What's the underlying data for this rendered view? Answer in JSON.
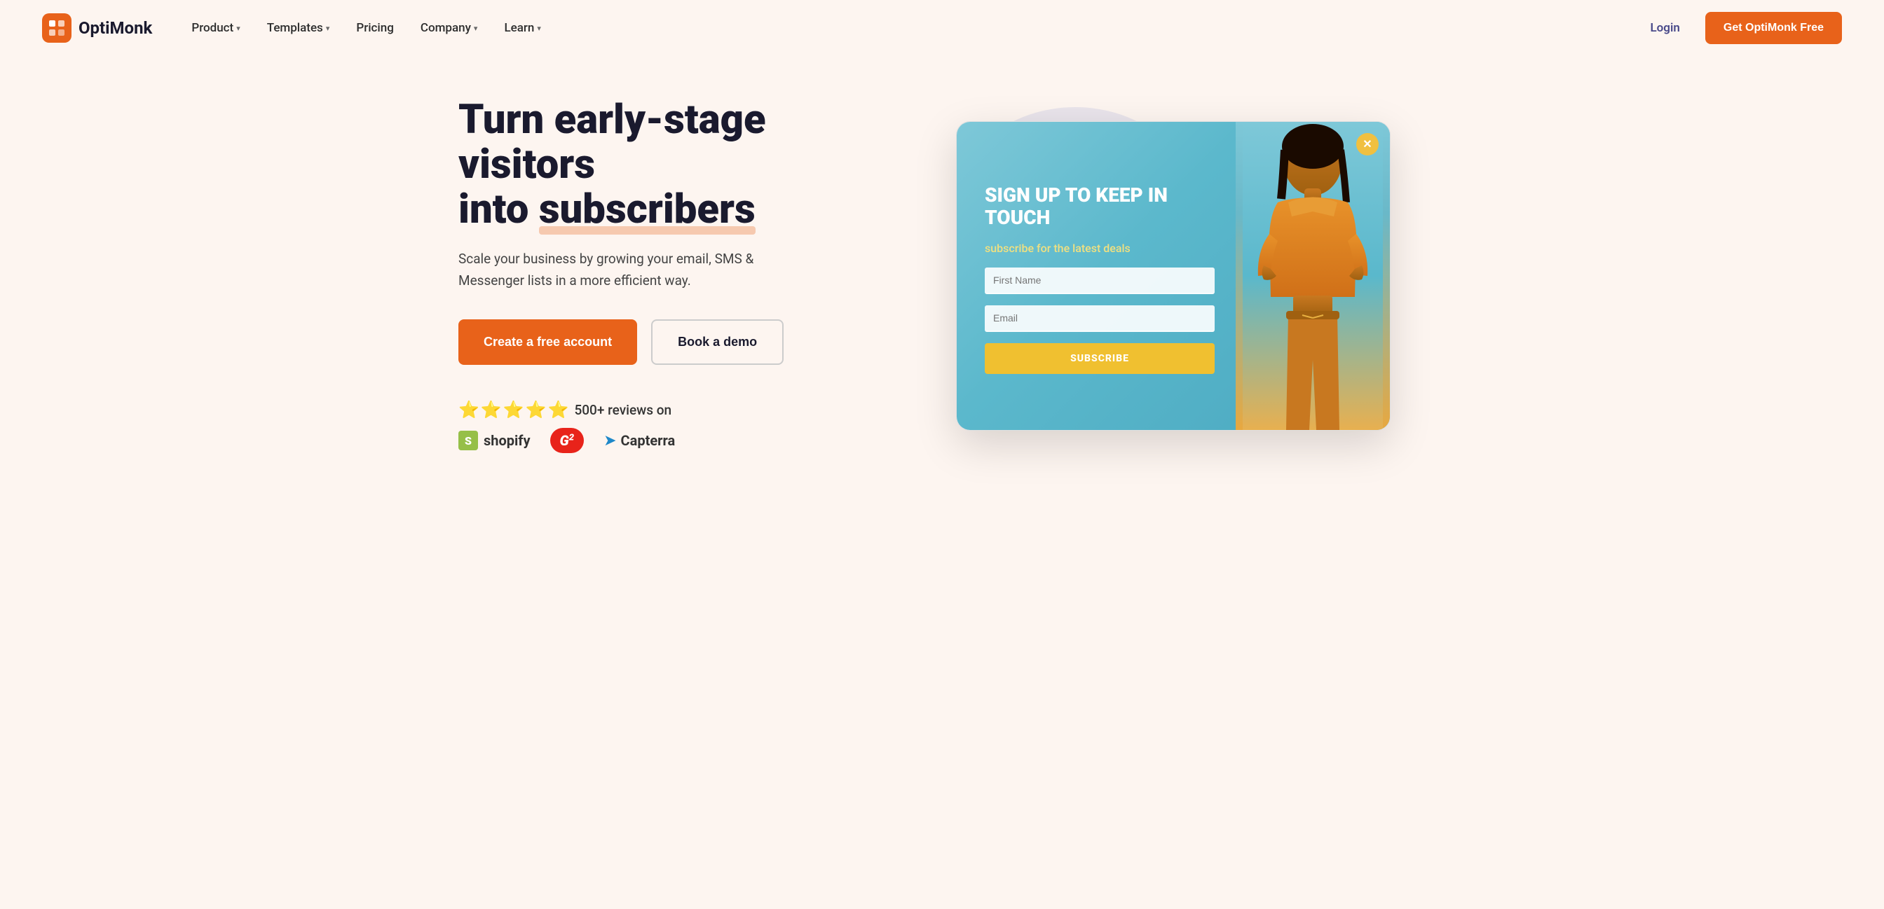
{
  "brand": {
    "name": "OptiMonk",
    "logo_alt": "OptiMonk logo"
  },
  "nav": {
    "items": [
      {
        "label": "Product",
        "has_dropdown": true
      },
      {
        "label": "Templates",
        "has_dropdown": true
      },
      {
        "label": "Pricing",
        "has_dropdown": false
      },
      {
        "label": "Company",
        "has_dropdown": true
      },
      {
        "label": "Learn",
        "has_dropdown": true
      }
    ],
    "login_label": "Login",
    "cta_label": "Get OptiMonk Free"
  },
  "hero": {
    "title_line1": "Turn early-stage visitors",
    "title_line2": "into ",
    "title_highlight": "subscribers",
    "subtitle": "Scale your business by growing your email, SMS & Messenger lists in a more efficient way.",
    "btn_primary": "Create a free account",
    "btn_secondary": "Book a demo",
    "reviews_text": "500+ reviews on",
    "stars": [
      "⭐",
      "⭐",
      "⭐",
      "⭐",
      "⭐"
    ],
    "platforms": [
      "Shopify",
      "G2",
      "Capterra"
    ]
  },
  "preview": {
    "close_icon": "✕",
    "heading": "SIGN UP TO KEEP IN TOUCH",
    "subheading": "subscribe for the latest deals",
    "field_first_name": "First Name",
    "field_email": "Email",
    "subscribe_label": "SUBSCRIBE"
  }
}
